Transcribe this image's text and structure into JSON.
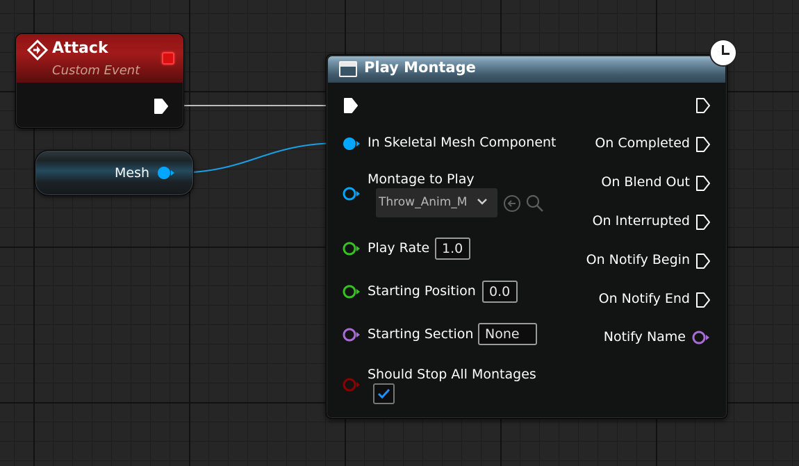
{
  "event_node": {
    "title": "Attack",
    "subtitle": "Custom Event",
    "header_color": "#a11a1a"
  },
  "mesh_node": {
    "label": "Mesh"
  },
  "montage_node": {
    "title": "Play Montage",
    "inputs": {
      "skeletal_mesh": "In Skeletal Mesh Component",
      "montage": "Montage to Play",
      "montage_value": "Throw_Anim_M",
      "play_rate": "Play Rate",
      "play_rate_value": "1.0",
      "starting_position": "Starting Position",
      "starting_position_value": "0.0",
      "starting_section": "Starting Section",
      "starting_section_value": "None",
      "stop_all": "Should Stop All Montages",
      "stop_all_checked": true
    },
    "outputs": {
      "on_completed": "On Completed",
      "on_blend_out": "On Blend Out",
      "on_interrupted": "On Interrupted",
      "on_notify_begin": "On Notify Begin",
      "on_notify_end": "On Notify End",
      "notify_name": "Notify Name"
    }
  },
  "pin_colors": {
    "exec": "#ffffff",
    "object": "#00a6ff",
    "float": "#35c41f",
    "name": "#a96cd8",
    "bool": "#8c0000"
  },
  "icons": [
    "event-icon",
    "stop-icon",
    "function-icon",
    "clock-icon",
    "dropdown-chevron-icon",
    "use-selected-asset-icon",
    "browse-asset-icon",
    "checkmark-icon"
  ]
}
